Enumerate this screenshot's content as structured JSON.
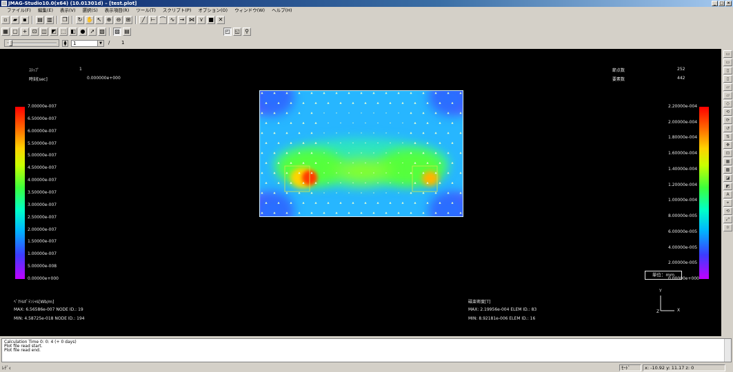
{
  "window": {
    "title": "JMAG-Studio10.0(x64) (10.01301d) – [test.plot]",
    "controls": [
      "_",
      "□",
      "×"
    ]
  },
  "menu": [
    "ファイル(F)",
    "編集(E)",
    "表示(V)",
    "選択(S)",
    "表示項目(R)",
    "ツール(T)",
    "スクリプト(P)",
    "オプション(O)",
    "ウィンドウ(W)",
    "ヘルプ(H)"
  ],
  "step_control": {
    "current": "1",
    "slash": "/",
    "total": "1"
  },
  "viewport": {
    "step_label": "ｽﾃｯﾌﾟ",
    "step_value": "1",
    "time_label": "時刻[sec]",
    "time_value": "0.000000e+000",
    "nodes_label": "節点数",
    "nodes_value": "252",
    "elements_label": "要素数",
    "elements_value": "442",
    "left_legend": {
      "ticks": [
        "7.00000e-007",
        "6.50000e-007",
        "6.00000e-007",
        "5.50000e-007",
        "5.00000e-007",
        "4.50000e-007",
        "4.00000e-007",
        "3.50000e-007",
        "3.00000e-007",
        "2.50000e-007",
        "2.00000e-007",
        "1.50000e-007",
        "1.00000e-007",
        "5.00000e-008",
        "0.00000e+000"
      ],
      "title": "ﾍﾞｸﾄﾙﾎﾟﾃﾝｼｬﾙ[Wb/m]",
      "max": "MAX: 6.56586e-007 NODE ID.: 19",
      "min": "MIN: 4.58725e-018 NODE ID.: 194"
    },
    "right_legend": {
      "ticks": [
        "2.20000e-004",
        "2.00000e-004",
        "1.80000e-004",
        "1.60000e-004",
        "1.40000e-004",
        "1.20000e-004",
        "1.00000e-004",
        "8.00000e-005",
        "6.00000e-005",
        "4.00000e-005",
        "2.00000e-005",
        "0.00000e+000"
      ],
      "title": "磁束密度[T]",
      "max": "MAX: 2.19956e-004 ELEM ID.: 83",
      "min": "MIN: 8.92181e-006 ELEM ID.: 16"
    },
    "axis": {
      "y": "Y",
      "x": "X",
      "z": "Z"
    },
    "unit": "単位：mm"
  },
  "log": [
    "Calculation Time     0: 0: 4 (+ 0 days)",
    "Plot file read start.",
    "Plot file read end."
  ],
  "status": {
    "left": "ﾚﾃﾞｨ",
    "mode": "ﾓｰﾄﾞ",
    "coords": "x: -10.92 y: 11.17 z:  0"
  }
}
